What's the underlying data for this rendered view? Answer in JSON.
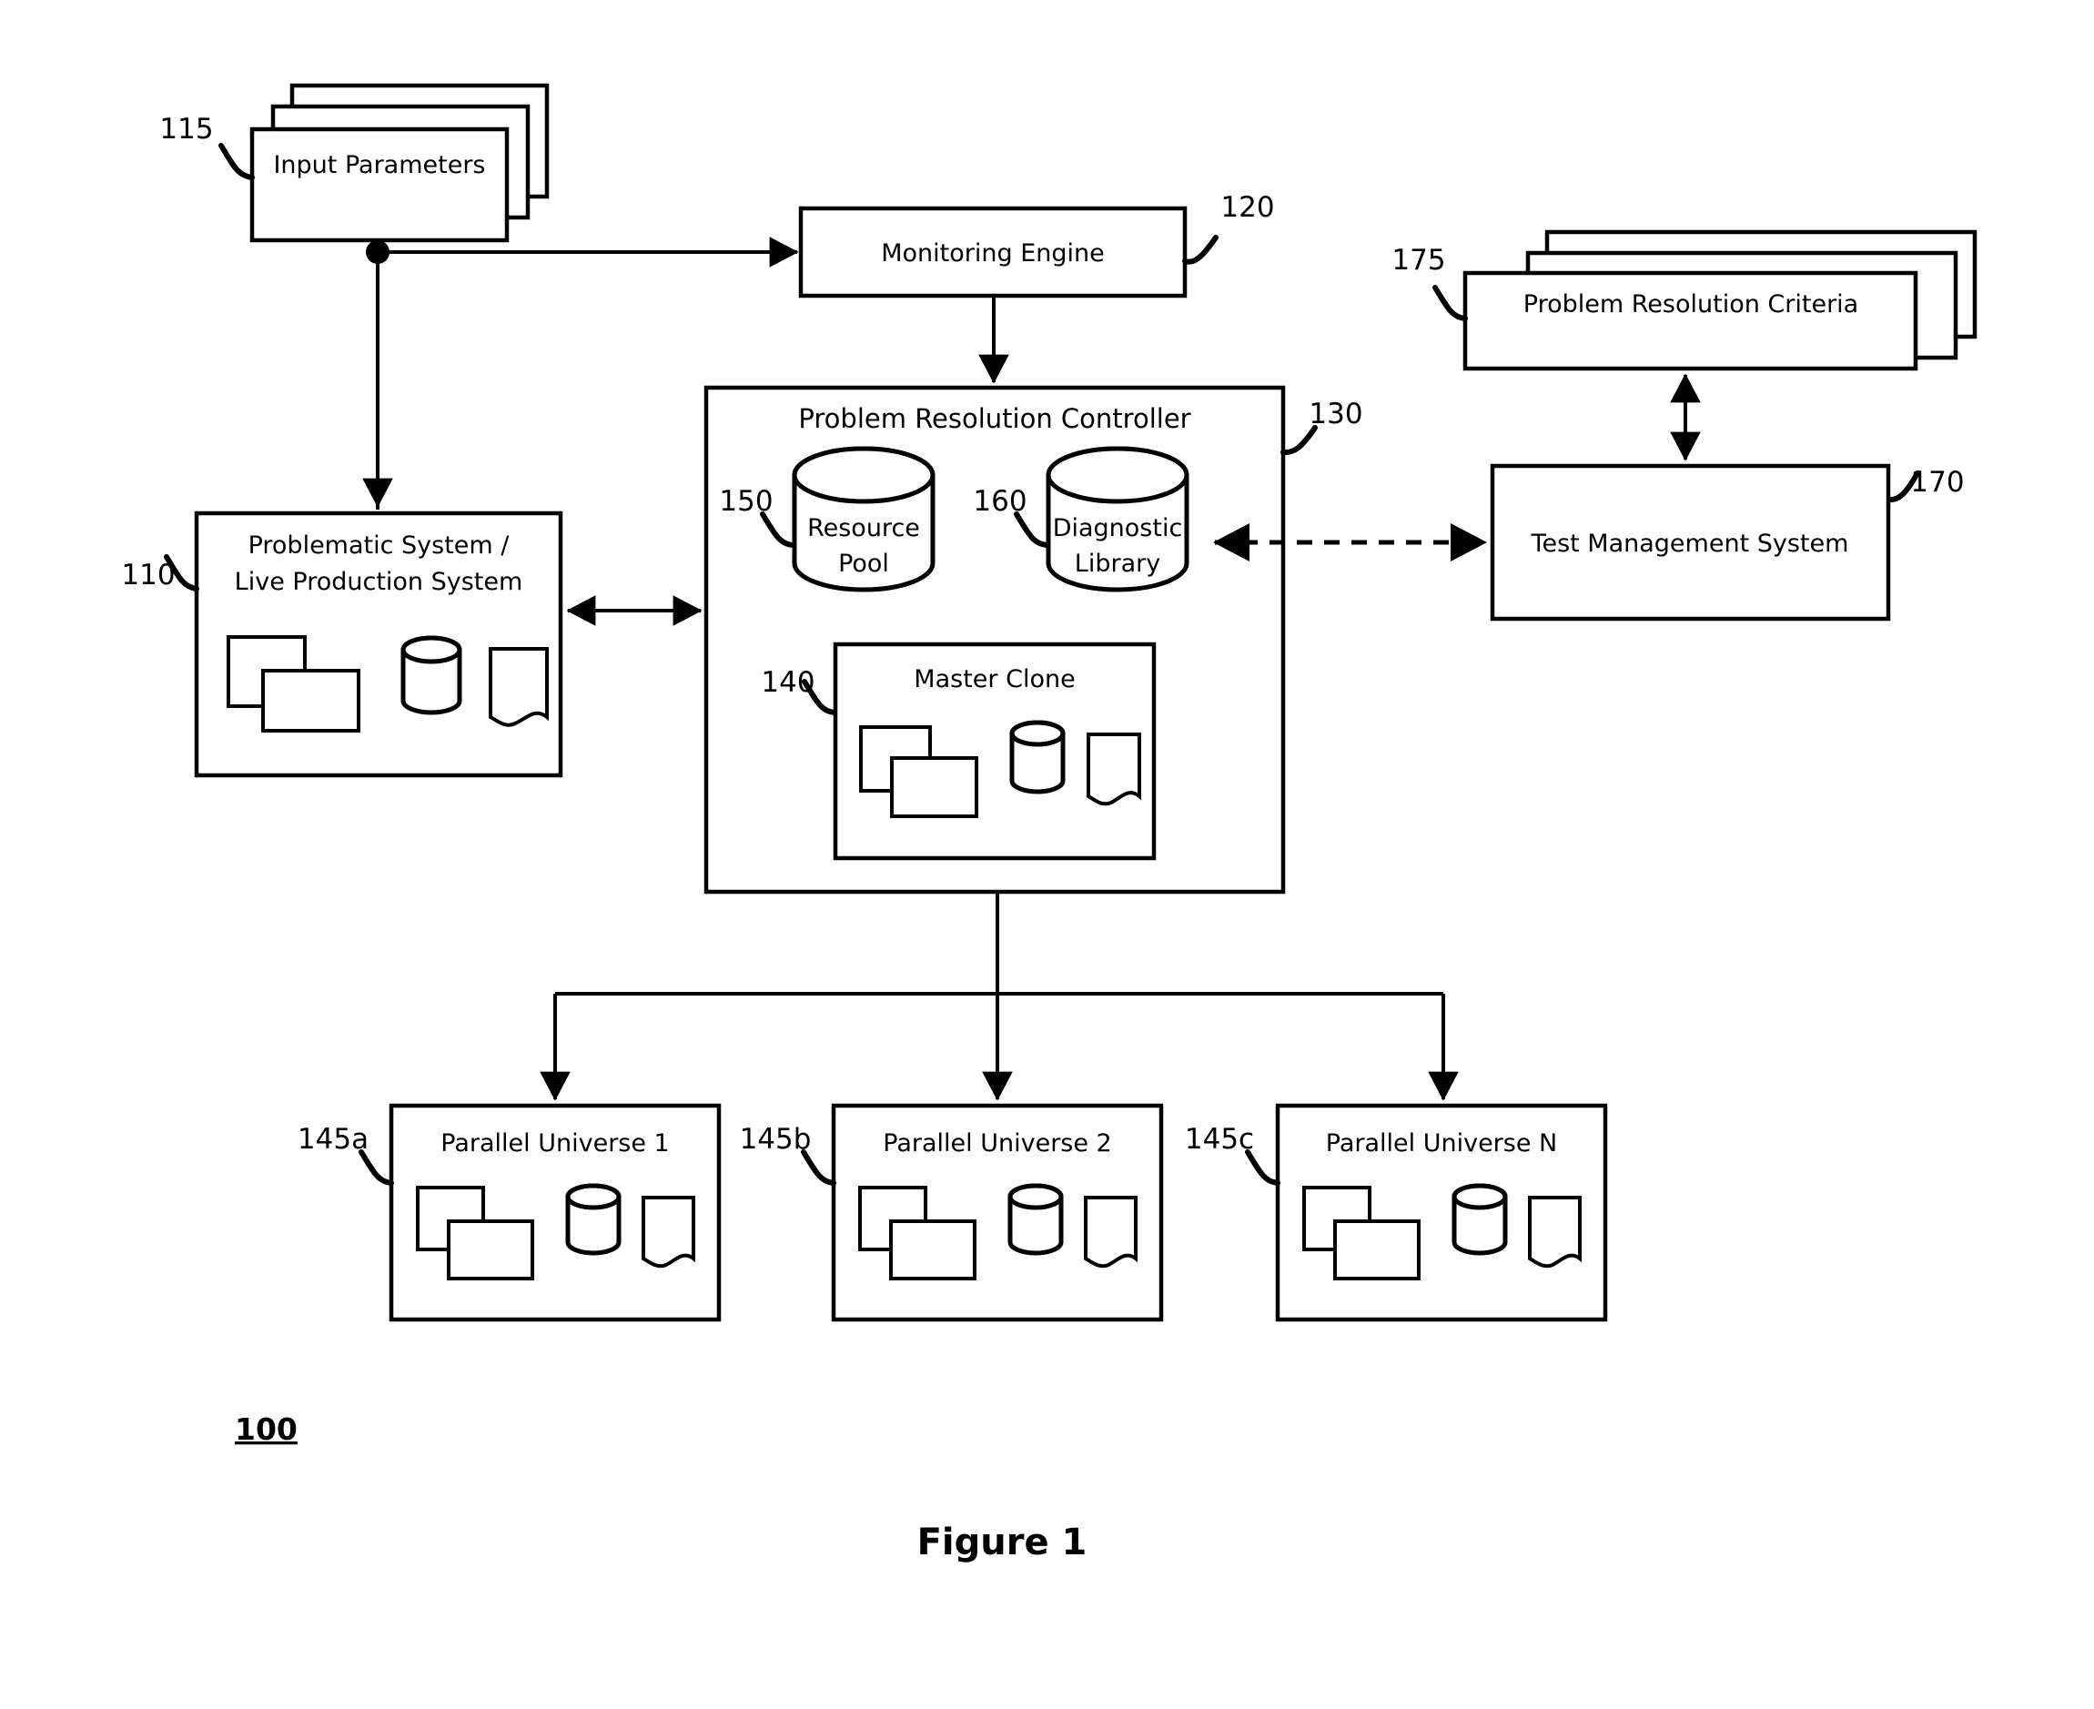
{
  "figure": {
    "caption": "Figure 1",
    "system_ref": "100"
  },
  "nodes": {
    "input_parameters": {
      "label": "Input Parameters",
      "ref": "115"
    },
    "monitoring_engine": {
      "label": "Monitoring Engine",
      "ref": "120"
    },
    "problematic_system": {
      "label_line1": "Problematic System /",
      "label_line2": "Live Production System",
      "ref": "110"
    },
    "problem_resolution_controller": {
      "label": "Problem Resolution Controller",
      "ref": "130"
    },
    "resource_pool": {
      "label_line1": "Resource",
      "label_line2": "Pool",
      "ref": "150"
    },
    "diagnostic_library": {
      "label_line1": "Diagnostic",
      "label_line2": "Library",
      "ref": "160"
    },
    "master_clone": {
      "label": "Master Clone",
      "ref": "140"
    },
    "problem_resolution_criteria": {
      "label": "Problem Resolution Criteria",
      "ref": "175"
    },
    "test_management_system": {
      "label": "Test Management System",
      "ref": "170"
    },
    "parallel_universe_1": {
      "label": "Parallel Universe 1",
      "ref": "145a"
    },
    "parallel_universe_2": {
      "label": "Parallel Universe 2",
      "ref": "145b"
    },
    "parallel_universe_n": {
      "label": "Parallel Universe N",
      "ref": "145c"
    }
  },
  "icons": {
    "server_stack": "overlapping-rectangles-icon",
    "database": "database-cylinder-icon",
    "document": "document-page-icon"
  },
  "colors": {
    "stroke": "#000000",
    "background": "#ffffff"
  }
}
